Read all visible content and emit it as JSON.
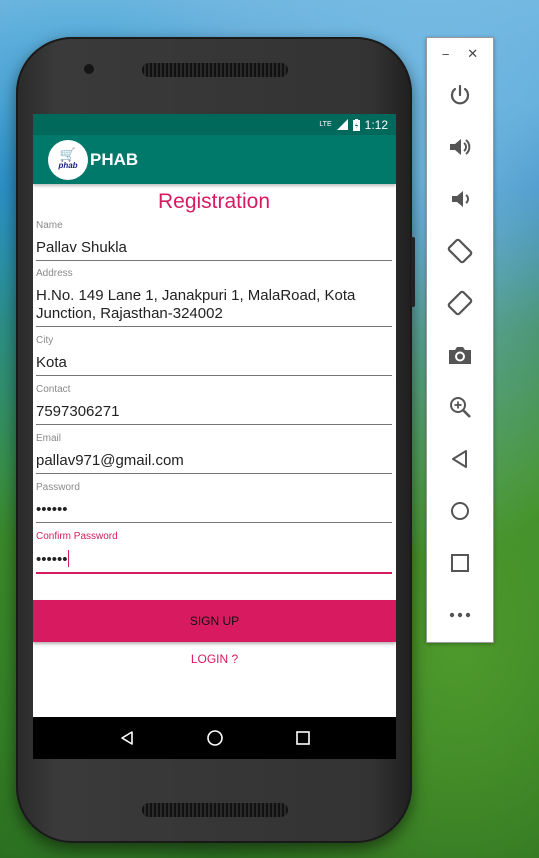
{
  "status_bar": {
    "network": "LTE",
    "time": "1:12"
  },
  "app_bar": {
    "logo_text": "phab",
    "title": "PHAB"
  },
  "page_title": "Registration",
  "fields": [
    {
      "label": "Name",
      "value": "Pallav Shukla"
    },
    {
      "label": "Address",
      "value_line1": "H.No. 149 Lane 1, Janakpuri 1, MalaRoad, Kota",
      "value_line2": "Junction, Rajasthan-324002"
    },
    {
      "label": "City",
      "value": "Kota"
    },
    {
      "label": "Contact",
      "value": "7597306271"
    },
    {
      "label": "Email",
      "value": "pallav971@gmail.com"
    },
    {
      "label": "Password",
      "value": "••••••"
    },
    {
      "label": "Confirm Password",
      "value": "••••••"
    }
  ],
  "signup_label": "SIGN UP",
  "login_label": "LOGIN ?",
  "colors": {
    "primary": "#00796b",
    "primary_dark": "#00695c",
    "accent": "#d81b60"
  },
  "emulator_toolbar": {
    "icons": [
      "power-icon",
      "volume-up-icon",
      "volume-down-icon",
      "rotate-left-icon",
      "rotate-right-icon",
      "camera-icon",
      "zoom-icon",
      "back-icon",
      "home-icon",
      "overview-icon",
      "more-icon"
    ]
  }
}
